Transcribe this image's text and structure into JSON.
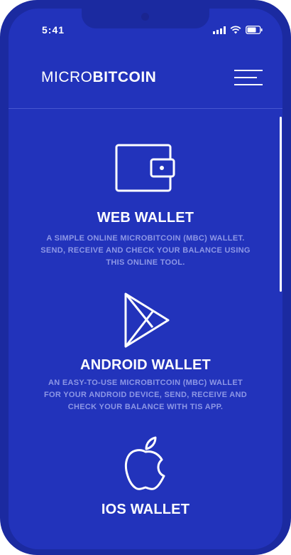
{
  "status_bar": {
    "time": "5:41"
  },
  "header": {
    "logo_light": "MICRO",
    "logo_bold": "BITCOIN"
  },
  "features": [
    {
      "title": "WEB WALLET",
      "description": "A SIMPLE ONLINE MICROBITCOIN (MBC) WALLET. SEND, RECEIVE AND CHECK YOUR BALANCE USING THIS ONLINE TOOL.",
      "icon": "wallet-icon"
    },
    {
      "title": "ANDROID WALLET",
      "description": "AN EASY-TO-USE MICROBITCOIN (MBC) WALLET FOR YOUR ANDROID DEVICE, SEND, RECEIVE AND CHECK YOUR BALANCE WITH TIS APP.",
      "icon": "play-store-icon"
    },
    {
      "title": "IOS WALLET",
      "icon": "apple-icon"
    }
  ],
  "colors": {
    "background": "#2233bb",
    "frame": "#1b2aa0",
    "text": "#ffffff",
    "muted_text": "#8d97e6"
  }
}
